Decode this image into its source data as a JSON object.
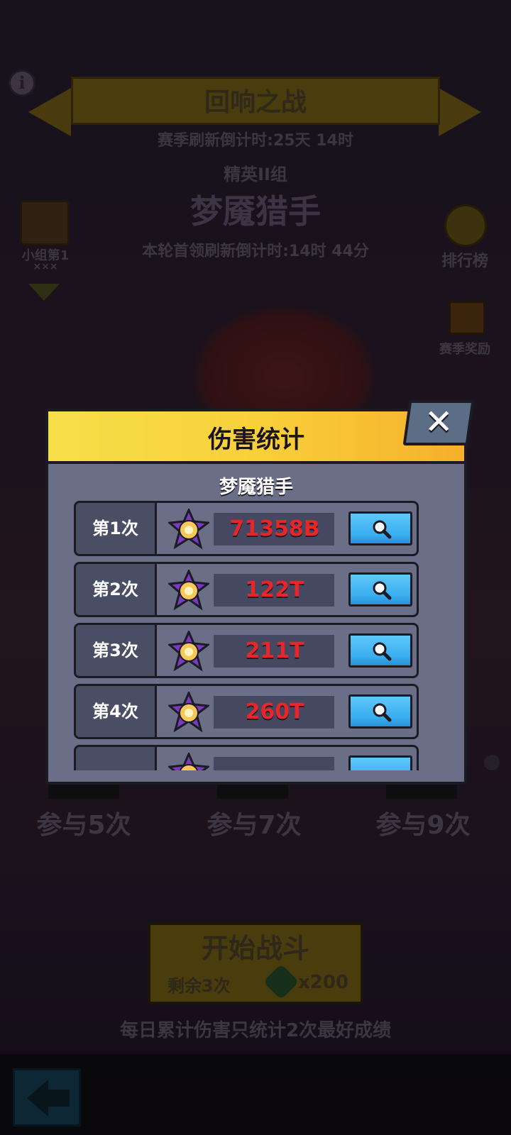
{
  "background": {
    "event_title": "回响之战",
    "season_countdown": "赛季刷新倒计时:25天 14时",
    "group_label": "精英II组",
    "boss_name": "梦魇猎手",
    "leader_countdown": "本轮首领刷新倒计时:14时 44分",
    "group_rank": "小组第1",
    "group_rank_sub": "×××",
    "leaderboard_label": "排行榜",
    "season_reward_label": "赛季奖励",
    "milestones": [
      "参与5次",
      "参与7次",
      "参与9次"
    ],
    "start_button": {
      "title": "开始战斗",
      "remaining": "剩余3次",
      "cost": "x200"
    },
    "daily_note": "每日累计伤害只统计2次最好成绩"
  },
  "modal": {
    "title": "伤害统计",
    "close_icon": "close-x",
    "boss_name": "梦魇猎手",
    "rows": [
      {
        "label": "第1次",
        "damage": "71358B"
      },
      {
        "label": "第2次",
        "damage": "122T"
      },
      {
        "label": "第3次",
        "damage": "211T"
      },
      {
        "label": "第4次",
        "damage": "260T"
      },
      {
        "label": "",
        "damage": ""
      }
    ]
  },
  "colors": {
    "header_gold": "#f8d03a",
    "damage_red": "#e8262a",
    "inspect_blue": "#3aaef0",
    "panel_gray": "#6a6e86"
  }
}
